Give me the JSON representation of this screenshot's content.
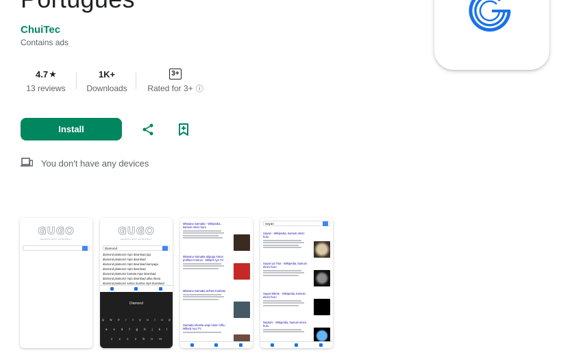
{
  "app": {
    "title": "Portugues",
    "developer": "ChuiTec",
    "ads_notice": "Contains ads"
  },
  "stats": {
    "rating": "4.7",
    "rating_star": "★",
    "reviews": "13 reviews",
    "downloads": "1K+",
    "downloads_label": "Downloads",
    "content_rating_badge": "3+",
    "content_rating_label": "Rated for 3+",
    "info_icon": "ⓘ"
  },
  "actions": {
    "install_label": "Install",
    "share_icon": "share-icon",
    "wishlist_icon": "bookmark-add-icon"
  },
  "devices": {
    "icon": "devices-icon",
    "message": "You don't have any devices"
  },
  "colors": {
    "brand_green": "#01875f",
    "icon_blue": "#1a73e8"
  },
  "screenshots": {
    "logo_text": "GUGO",
    "logo_subtext": "SEARCH BOX RANDOMLY",
    "shot2_query": "Diamond",
    "shot2_suggestions": [
      "diamond platnumz mp3 download jojo",
      "diamond platnumz mp3 download",
      "diamond platnumz mp3 download kamyaga",
      "diamond platnumz mp3 download",
      "diamond platnumz kamata mp3 download",
      "diamond platnumz mp3 download utika rikura",
      "diamond platnumz samia mutima mp3 download"
    ],
    "keyboard_rows": [
      [
        "q",
        "w",
        "e",
        "r",
        "t",
        "y",
        "u",
        "i",
        "o",
        "p"
      ],
      [
        "a",
        "s",
        "d",
        "f",
        "g",
        "h",
        "j",
        "k",
        "l"
      ],
      [
        "z",
        "x",
        "c",
        "v",
        "b",
        "n",
        "m"
      ]
    ],
    "shot3_results": [
      "Mbwana Samatta - Wikipedia, kamusi elezo huru",
      "Mbwana Samatta alipogo Aston profiled Antonio - Millard Ayo TV",
      "Mbwana Samatta achwa Kushoto",
      "Samatta shusha wapi Aston Villa - Millard Ayo TV"
    ],
    "shot4_query": "Sayari",
    "shot4_results": [
      "Sayari - Wikipedia, kamusi elezo huru",
      "Sayari ya Tisa - Wikipedia, kamusi elezo huru",
      "Sayari kibete - Wikipedia, kamusi elezo huru",
      "Neptuni - Wikipedia, kamusi elezo huru"
    ]
  }
}
